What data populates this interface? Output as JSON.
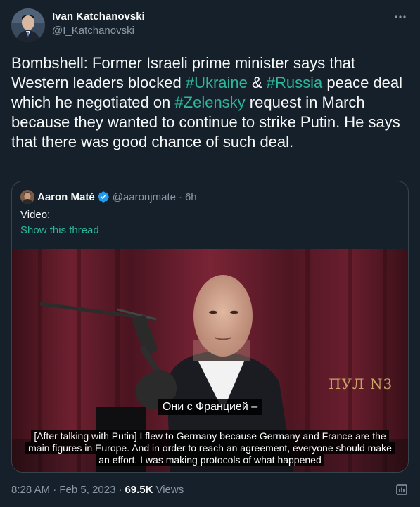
{
  "tweet": {
    "author": {
      "display_name": "Ivan Katchanovski",
      "handle": "@I_Katchanovski"
    },
    "more_icon": "more-horizontal-icon",
    "text_parts": {
      "p1": "Bombshell: Former Israeli prime minister says that Western leaders blocked ",
      "tag1": "#Ukraine",
      "p2": " & ",
      "tag2": "#Russia",
      "p3": " peace deal which he negotiated on ",
      "tag3": "#Zelensky",
      "p4": " request in March because they wanted to continue to strike Putin. He says that there was good chance of such deal."
    },
    "hashtag_color": "#2cb89a",
    "timestamp": "8:28 AM · Feb 5, 2023",
    "views_count": "69.5K",
    "views_label": "Views"
  },
  "quote": {
    "display_name": "Aaron Maté",
    "handle": "@aaronjmate",
    "separator": "·",
    "time": "6h",
    "text": "Video:",
    "show_thread": "Show this thread",
    "video": {
      "logo_text": "ПУЛ N3",
      "subtitle_ru": "Они с Францией –",
      "subtitle_en": "[After talking with Putin] I flew to Germany because Germany and France are the main figures in Europe. And in order to reach an agreement, everyone should make an effort. I was making protocols of what happened"
    }
  },
  "colors": {
    "background": "#15202b",
    "primary_text": "#f7f9f9",
    "secondary_text": "#8b98a5",
    "border": "#38444d",
    "verified": "#1d9bf0"
  }
}
